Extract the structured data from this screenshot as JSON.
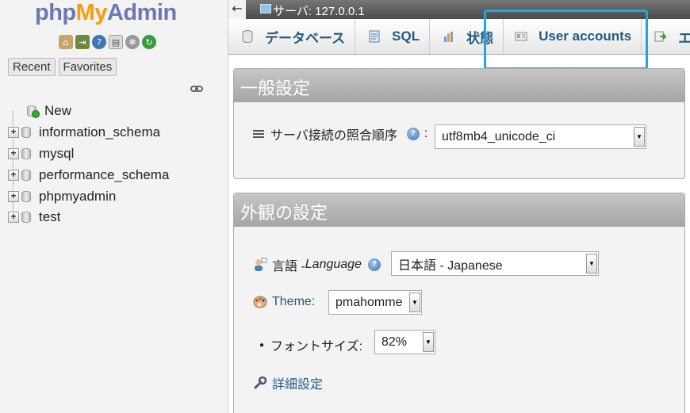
{
  "nav": {
    "logo": {
      "php": "php",
      "my": "My",
      "admin": "Admin"
    },
    "icons": [
      "home-icon",
      "exit-icon",
      "help-icon",
      "docs-icon",
      "settings-icon",
      "reload-icon"
    ],
    "tabs": [
      {
        "label": "Recent"
      },
      {
        "label": "Favorites"
      }
    ],
    "tree": [
      {
        "label": "New",
        "expandable": false
      },
      {
        "label": "information_schema",
        "expandable": true
      },
      {
        "label": "mysql",
        "expandable": true
      },
      {
        "label": "performance_schema",
        "expandable": true
      },
      {
        "label": "phpmyadmin",
        "expandable": true
      },
      {
        "label": "test",
        "expandable": true
      }
    ]
  },
  "topbar": {
    "back": "←",
    "server": "サーバ: 127.0.0.1"
  },
  "tabs": [
    {
      "label": "データベース",
      "icon": "database-icon"
    },
    {
      "label": "SQL",
      "icon": "sql-icon"
    },
    {
      "label": "状態",
      "icon": "status-icon"
    },
    {
      "label": "User accounts",
      "icon": "user-accounts-icon"
    },
    {
      "label": "エク",
      "icon": "export-icon"
    }
  ],
  "general": {
    "title": "一般設定",
    "collation_label": "サーバ接続の照合順序",
    "colon": ":",
    "collation_value": "utf8mb4_unicode_ci"
  },
  "appearance": {
    "title": "外観の設定",
    "language_label_ja": "言語 - ",
    "language_label_en": "Language",
    "language_value": "日本語 - Japanese",
    "theme_label": "Theme:",
    "theme_value": "pmahomme",
    "font_size_label": "フォントサイズ:",
    "font_size_value": "82%",
    "more_settings": "詳細設定"
  },
  "colors": {
    "accent_highlight": "#1ba8e0",
    "link": "#235a81"
  }
}
